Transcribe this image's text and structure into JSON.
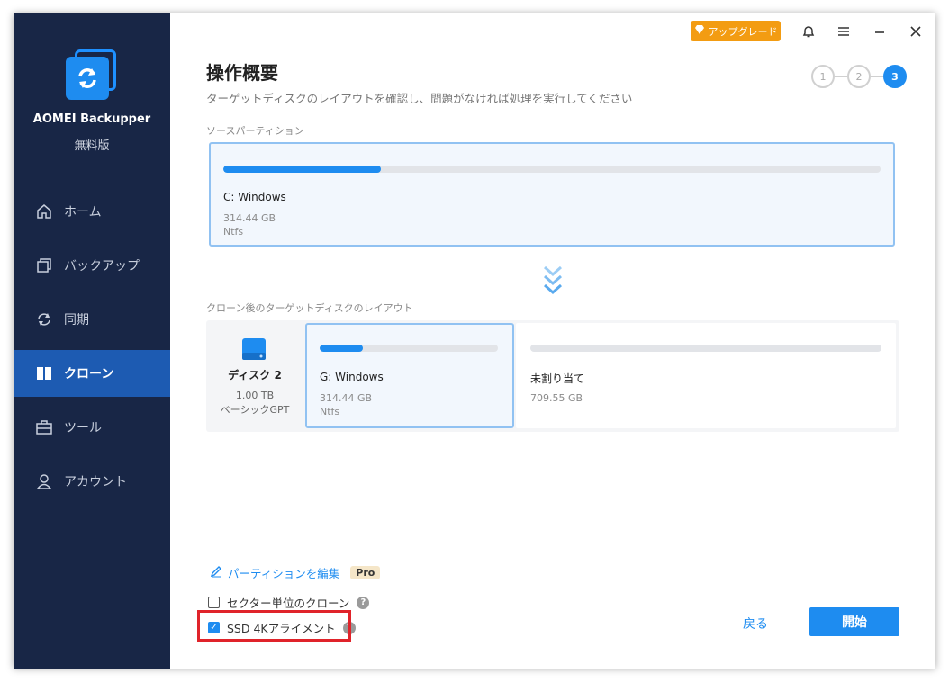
{
  "sidebar": {
    "app_name": "AOMEI Backupper",
    "edition": "無料版",
    "items": [
      {
        "label": "ホーム",
        "icon": "home-icon"
      },
      {
        "label": "バックアップ",
        "icon": "backup-icon"
      },
      {
        "label": "同期",
        "icon": "sync-icon"
      },
      {
        "label": "クローン",
        "icon": "clone-icon",
        "active": true
      },
      {
        "label": "ツール",
        "icon": "tools-icon"
      },
      {
        "label": "アカウント",
        "icon": "account-icon"
      }
    ]
  },
  "titlebar": {
    "upgrade_label": "アップグレード"
  },
  "page": {
    "title": "操作概要",
    "subtitle": "ターゲットディスクのレイアウトを確認し、問題がなければ処理を実行してください",
    "steps": [
      "1",
      "2",
      "3"
    ],
    "current_step": 3
  },
  "source": {
    "section_label": "ソースパーティション",
    "partition": {
      "name": "C: Windows",
      "size": "314.44 GB",
      "fs": "Ntfs",
      "used_fraction": 0.24
    }
  },
  "target": {
    "section_label": "クローン後のターゲットディスクのレイアウト",
    "disk": {
      "name": "ディスク 2",
      "size": "1.00 TB",
      "type": "ベーシックGPT"
    },
    "partitions": [
      {
        "name": "G: Windows",
        "size": "314.44 GB",
        "fs": "Ntfs",
        "used_fraction": 0.24
      },
      {
        "name": "未割り当て",
        "size": "709.55 GB",
        "used_fraction": 0
      }
    ]
  },
  "options": {
    "edit_partition_label": "パーティションを編集",
    "pro_badge": "Pro",
    "sector_clone_label": "セクター単位のクローン",
    "sector_clone_checked": false,
    "ssd_align_label": "SSD 4Kアライメント",
    "ssd_align_checked": true,
    "help_symbol": "?"
  },
  "footer": {
    "back_label": "戻る",
    "start_label": "開始"
  },
  "colors": {
    "sidebar_bg": "#182646",
    "accent": "#1e8cf0",
    "upgrade": "#f39c12",
    "highlight": "#e0232a"
  }
}
